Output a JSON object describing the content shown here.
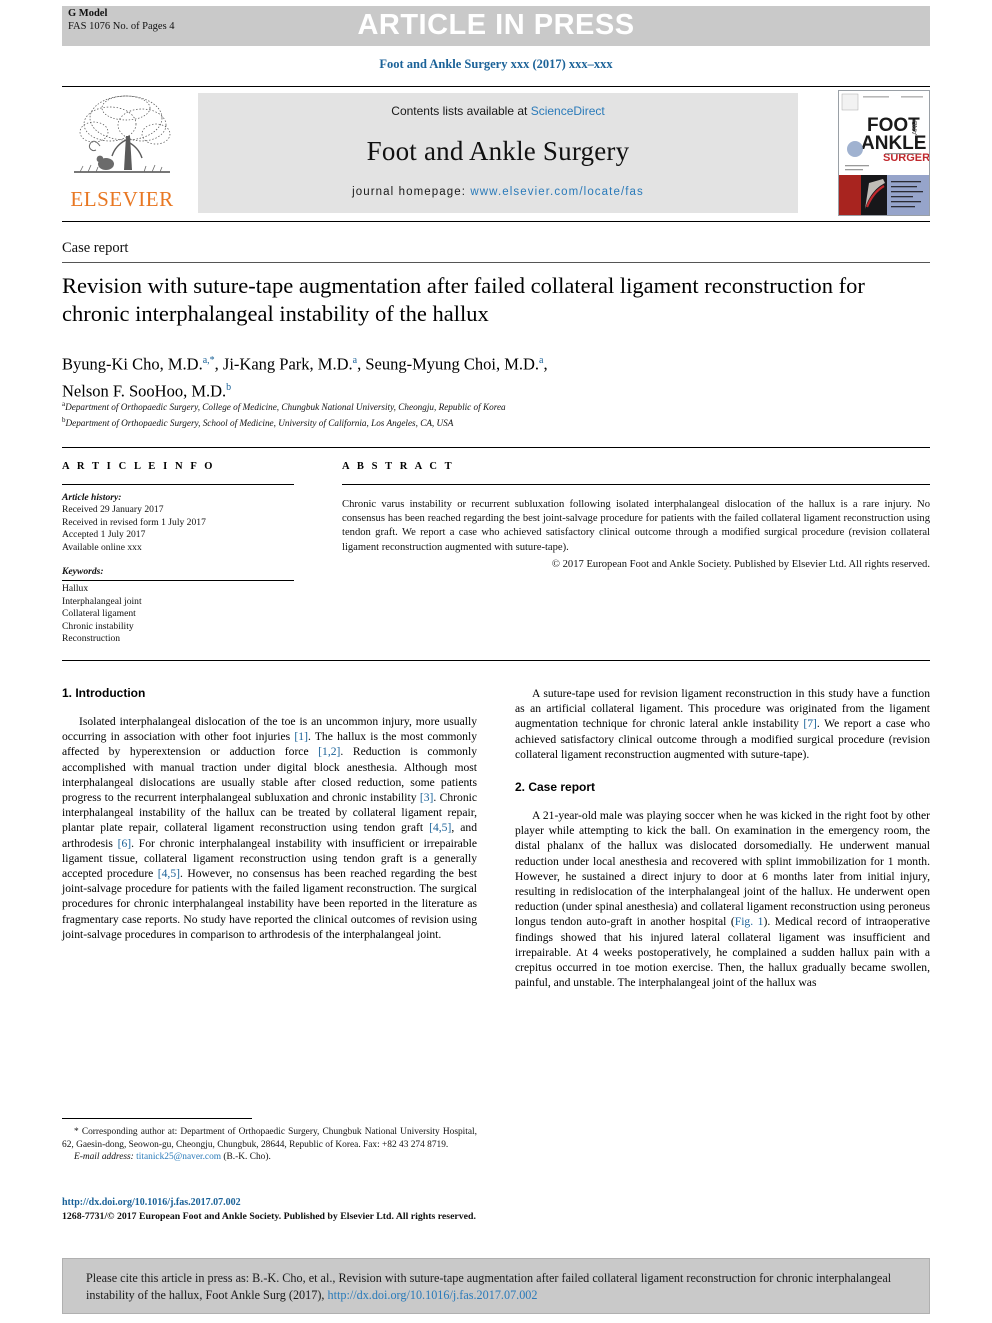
{
  "banner": {
    "g_model_line1": "G Model",
    "g_model_line2": "FAS 1076 No. of Pages 4",
    "article_in_press": "ARTICLE IN PRESS",
    "journal_running_head": "Foot and Ankle Surgery xxx (2017) xxx–xxx"
  },
  "masthead": {
    "contents_prefix": "Contents lists available at ",
    "contents_link": "ScienceDirect",
    "journal_title": "Foot and Ankle Surgery",
    "homepage_label": "journal homepage:",
    "homepage_link": "www.elsevier.com/locate/fas",
    "publisher_wordmark": "ELSEVIER",
    "cover_title_line1": "FOOT",
    "cover_title_line2": "ANKLE",
    "cover_title_line3": "SURGERY",
    "cover_side_text": "AND"
  },
  "article": {
    "type_label": "Case report",
    "title": "Revision with suture-tape augmentation after failed collateral ligament reconstruction for chronic interphalangeal instability of the hallux",
    "authors_line1_part1": "Byung-Ki Cho, M.D.",
    "authors_sup1": "a,*",
    "authors_line1_part2": ", Ji-Kang Park, M.D.",
    "authors_sup2": "a",
    "authors_line1_part3": ", Seung-Myung Choi, M.D.",
    "authors_sup3": "a",
    "authors_line1_part4": ",",
    "authors_line2_part1": "Nelson F. SooHoo, M.D.",
    "authors_sup4": "b",
    "affiliation_a_marker": "a",
    "affiliation_a": "Department of Orthopaedic Surgery, College of Medicine, Chungbuk National University, Cheongju, Republic of Korea",
    "affiliation_b_marker": "b",
    "affiliation_b": "Department of Orthopaedic Surgery, School of Medicine, University of California, Los Angeles, CA, USA"
  },
  "info": {
    "header": "A R T I C L E   I N F O",
    "history_label": "Article history:",
    "history": [
      "Received 29 January 2017",
      "Received in revised form 1 July 2017",
      "Accepted 1 July 2017",
      "Available online xxx"
    ],
    "keywords_label": "Keywords:",
    "keywords": [
      "Hallux",
      "Interphalangeal joint",
      "Collateral ligament",
      "Chronic instability",
      "Reconstruction"
    ]
  },
  "abstract": {
    "header": "A B S T R A C T",
    "text": "Chronic varus instability or recurrent subluxation following isolated interphalangeal dislocation of the hallux is a rare injury. No consensus has been reached regarding the best joint-salvage procedure for patients with the failed collateral ligament reconstruction using tendon graft. We report a case who achieved satisfactory clinical outcome through a modified surgical procedure (revision collateral ligament reconstruction augmented with suture-tape).",
    "copyright": "© 2017 European Foot and Ankle Society. Published by Elsevier Ltd. All rights reserved."
  },
  "body": {
    "section1_heading": "1. Introduction",
    "intro_p1_a": "Isolated interphalangeal dislocation of the toe is an uncommon injury, more usually occurring in association with other foot injuries ",
    "intro_ref1": "[1]",
    "intro_p1_b": ". The hallux is the most commonly affected by hyperextension or adduction force ",
    "intro_ref2": "[1,2]",
    "intro_p1_c": ". Reduction is commonly accomplished with manual traction under digital block anesthesia. Although most interphalangeal dislocations are usually stable after closed reduction, some patients progress to the recurrent interphalangeal subluxation and chronic instability ",
    "intro_ref3": "[3]",
    "intro_p1_d": ". Chronic interphalangeal instability of the hallux can be treated by collateral ligament repair, plantar plate repair, collateral ligament reconstruction using tendon graft ",
    "intro_ref4": "[4,5]",
    "intro_p1_e": ", and arthrodesis ",
    "intro_ref5": "[6]",
    "intro_p1_f": ". For chronic interphalangeal instability with insufficient or irrepairable ligament tissue, collateral ligament reconstruction using tendon graft is a generally accepted procedure ",
    "intro_ref6": "[4,5]",
    "intro_p1_g": ". However, no consensus has been reached regarding the best joint-salvage procedure for patients with the failed ligament reconstruction. The surgical procedures for chronic interphalangeal instability have been reported in the literature as fragmentary case reports. No study have reported the clinical outcomes of revision using joint-salvage procedures in comparison to arthrodesis of the interphalangeal joint.",
    "intro_p2_a": "A suture-tape used for revision ligament reconstruction in this study have a function as an artificial collateral ligament. This procedure was originated from the ligament augmentation technique for chronic lateral ankle instability ",
    "intro_ref7": "[7]",
    "intro_p2_b": ". We report a case who achieved satisfactory clinical outcome through a modified surgical procedure (revision collateral ligament reconstruction augmented with suture-tape).",
    "section2_heading": "2. Case report",
    "case_p1_a": "A 21-year-old male was playing soccer when he was kicked in the right foot by other player while attempting to kick the ball. On examination in the emergency room, the distal phalanx of the hallux was dislocated dorsomedially. He underwent manual reduction under local anesthesia and recovered with splint immobilization for 1 month. However, he sustained a direct injury to door at 6 months later from initial injury, resulting in redislocation of the interphalangeal joint of the hallux. He underwent open reduction (under spinal anesthesia) and collateral ligament reconstruction using peroneus longus tendon auto-graft in another hospital (",
    "case_figref": "Fig. 1",
    "case_p1_b": "). Medical record of intraoperative findings showed that his injured lateral collateral ligament was insufficient and irrepairable. At 4 weeks postoperatively, he complained a sudden hallux pain with a crepitus occurred in toe motion exercise. Then, the hallux gradually became swollen, painful, and unstable. The interphalangeal joint of the hallux was"
  },
  "footnotes": {
    "corresponding_marker": "*",
    "corresponding": "Corresponding author at: Department of Orthopaedic Surgery, Chungbuk National University Hospital, 62, Gaesin-dong, Seowon-gu, Cheongju, Chungbuk, 28644, Republic of Korea. Fax: +82 43 274 8719.",
    "email_label": "E-mail address:",
    "email": "titanick25@naver.com",
    "email_owner": "(B.-K. Cho).",
    "doi": "http://dx.doi.org/10.1016/j.fas.2017.07.002",
    "issn_line": "1268-7731/© 2017 European Foot and Ankle Society. Published by Elsevier Ltd. All rights reserved."
  },
  "cite_box": {
    "text": "Please cite this article in press as: B.-K. Cho, et al., Revision with suture-tape augmentation after failed collateral ligament reconstruction for chronic interphalangeal instability of the hallux, Foot Ankle Surg (2017), ",
    "link": "http://dx.doi.org/10.1016/j.fas.2017.07.002"
  },
  "colors": {
    "link_blue": "#2a7ab9",
    "heading_blue": "#1b6298",
    "elsevier_orange": "#e87722",
    "banner_grey": "#c9c9c9",
    "band_grey": "#e3e3e3"
  }
}
